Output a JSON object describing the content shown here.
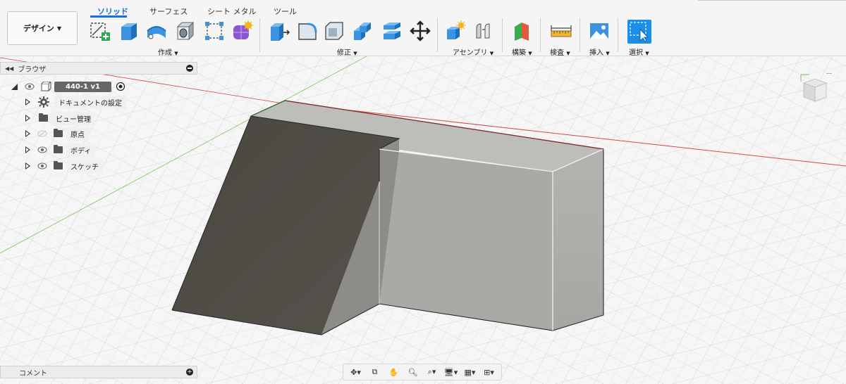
{
  "toolbar": {
    "design_label": "デザイン",
    "tabs": [
      "ソリッド",
      "サーフェス",
      "シート メタル",
      "ツール"
    ],
    "groups": {
      "create": "作成",
      "modify": "修正",
      "assemble": "アセンブリ",
      "construct": "構築",
      "inspect": "検査",
      "insert": "挿入",
      "select": "選択"
    }
  },
  "browser": {
    "title": "ブラウザ",
    "component": "440-1 v1",
    "items": [
      "ドキュメントの設定",
      "ビュー管理",
      "原点",
      "ボディ",
      "スケッチ"
    ]
  },
  "comments": {
    "title": "コメント"
  },
  "colors": {
    "accent": "#1a6fd6",
    "ramp_face": "#494640",
    "box_face": "#adadaa",
    "top_face": "#c7c7c4",
    "x_axis": "#d24a4a",
    "y_axis": "#7ac65a"
  }
}
